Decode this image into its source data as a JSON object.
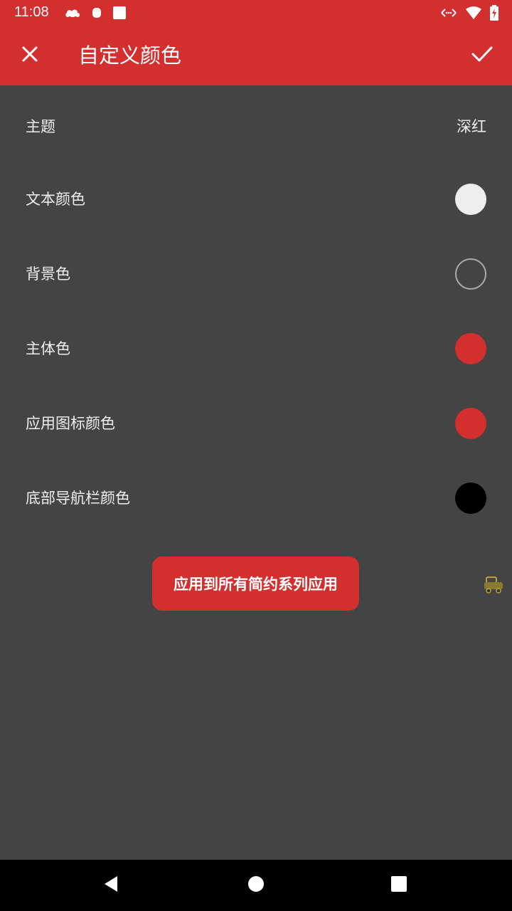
{
  "status_bar": {
    "time": "11:08",
    "left_icons": [
      "cloud-icon",
      "android-icon",
      "square-icon"
    ],
    "right_icons": [
      "data-arrows-icon",
      "wifi-icon",
      "battery-charging-icon"
    ]
  },
  "app_bar": {
    "title": "自定义颜色",
    "close_icon": "close-icon",
    "confirm_icon": "check-icon"
  },
  "rows": [
    {
      "label": "主题",
      "value": "深红"
    },
    {
      "label": "文本颜色",
      "swatch": "#eeeeee"
    },
    {
      "label": "背景色",
      "swatch": "#444444"
    },
    {
      "label": "主体色",
      "swatch": "#d32f2f"
    },
    {
      "label": "应用图标颜色",
      "swatch": "#d32f2f"
    },
    {
      "label": "底部导航栏颜色",
      "swatch": "#000000"
    }
  ],
  "apply_button": {
    "label": "应用到所有简约系列应用"
  },
  "nav_bar": {
    "icons": [
      "back-icon",
      "home-icon",
      "recents-icon"
    ]
  },
  "colors": {
    "accent": "#d32f2f",
    "background": "#444444",
    "text": "#f0f0f0"
  }
}
